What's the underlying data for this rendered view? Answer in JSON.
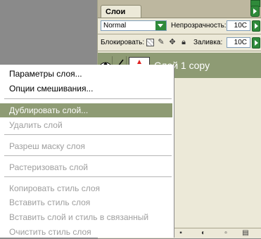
{
  "panel": {
    "tab_label": "Слои",
    "blend_mode": "Normal",
    "opacity_label": "Непрозрачность:",
    "opacity_value": "10C",
    "lock_label": "Блокировать:",
    "fill_label": "Заливка:",
    "fill_value": "10C",
    "layer_name": "Слой 1 copy"
  },
  "context_menu": {
    "items": [
      {
        "label": "Параметры слоя...",
        "state": "enabled"
      },
      {
        "label": "Опции смешивания...",
        "state": "enabled"
      },
      {
        "label": "Дублировать слой...",
        "state": "highlighted"
      },
      {
        "label": "Удалить слой",
        "state": "disabled"
      },
      {
        "label": "Разреш маску слоя",
        "state": "disabled"
      },
      {
        "label": "Растеризовать слой",
        "state": "disabled"
      },
      {
        "label": "Копировать стиль слоя",
        "state": "disabled"
      },
      {
        "label": "Вставить стиль слоя",
        "state": "disabled"
      },
      {
        "label": "Вставить слой и стиль в связанный",
        "state": "disabled"
      },
      {
        "label": "Очистить стиль слоя",
        "state": "disabled"
      }
    ]
  },
  "icons": {
    "eye": "eye-icon",
    "brush": "brush-icon",
    "lock_transparency": "lock-transparency-icon",
    "lock_paint": "lock-paint-icon",
    "lock_move": "lock-move-icon",
    "lock_all": "lock-all-icon"
  },
  "colors": {
    "selection": "#8e9b74",
    "panel_bg": "#ece9d8",
    "button_green": "#2f8a3a"
  }
}
